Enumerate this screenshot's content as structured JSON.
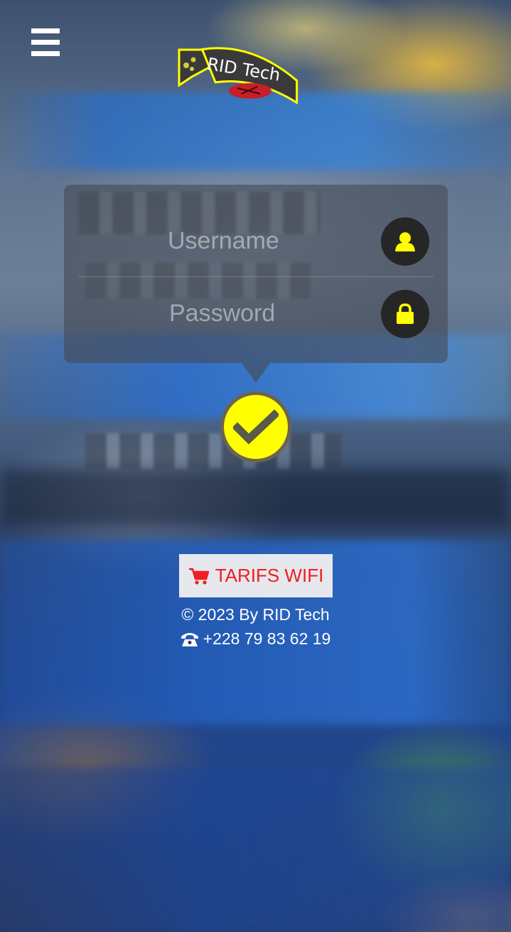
{
  "brand": {
    "logo_text": "RID Tech",
    "accent_color": "#ffff00",
    "logo_bubble_color": "#3a3a3a"
  },
  "menu": {
    "icon": "hamburger-menu-icon"
  },
  "login": {
    "username_placeholder": "Username",
    "password_placeholder": "Password",
    "username_icon": "user-icon",
    "password_icon": "lock-icon",
    "submit_icon": "check-icon"
  },
  "footer": {
    "tarifs_label": "TARIFS WIFI",
    "tarifs_icon": "cart-icon",
    "tarifs_color": "#ee1f1f",
    "copyright": "© 2023 By RID Tech",
    "phone_icon": "phone-icon",
    "phone": "+228 79 83 62 19"
  }
}
